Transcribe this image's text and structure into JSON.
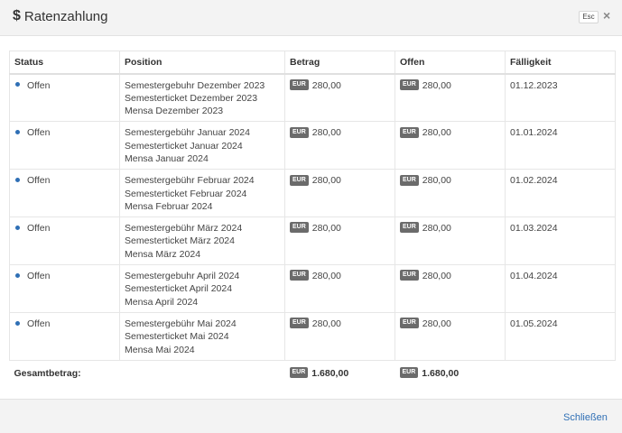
{
  "header": {
    "icon": "dollar-icon",
    "title": "Ratenzahlung",
    "esc_label": "Esc",
    "close_symbol": "×"
  },
  "table": {
    "columns": [
      "Status",
      "Position",
      "Betrag",
      "Offen",
      "Fälligkeit"
    ],
    "currency": "EUR",
    "rows": [
      {
        "status": "Offen",
        "pos1": "Semestergebuhr Dezember 2023",
        "pos2": "Semesterticket Dezember 2023",
        "pos3": "Mensa Dezember 2023",
        "betrag": "280,00",
        "offen": "280,00",
        "faellig": "01.12.2023"
      },
      {
        "status": "Offen",
        "pos1": "Semestergebühr Januar 2024",
        "pos2": "Semesterticket Januar 2024",
        "pos3": "Mensa Januar 2024",
        "betrag": "280,00",
        "offen": "280,00",
        "faellig": "01.01.2024"
      },
      {
        "status": "Offen",
        "pos1": "Semestergebühr Februar 2024",
        "pos2": "Semesterticket Februar 2024",
        "pos3": "Mensa Februar 2024",
        "betrag": "280,00",
        "offen": "280,00",
        "faellig": "01.02.2024"
      },
      {
        "status": "Offen",
        "pos1": "Semestergebühr März 2024",
        "pos2": "Semesterticket März 2024",
        "pos3": "Mensa März 2024",
        "betrag": "280,00",
        "offen": "280,00",
        "faellig": "01.03.2024"
      },
      {
        "status": "Offen",
        "pos1": "Semestergebuhr April 2024",
        "pos2": "Semesterticket April 2024",
        "pos3": "Mensa April 2024",
        "betrag": "280,00",
        "offen": "280,00",
        "faellig": "01.04.2024"
      },
      {
        "status": "Offen",
        "pos1": "Semestergebühr Mai 2024",
        "pos2": "Semesterticket Mai 2024",
        "pos3": "Mensa Mai 2024",
        "betrag": "280,00",
        "offen": "280,00",
        "faellig": "01.05.2024"
      }
    ],
    "total": {
      "label": "Gesamtbetrag:",
      "betrag": "1.680,00",
      "offen": "1.680,00"
    }
  },
  "footer": {
    "close_label": "Schließen"
  },
  "colors": {
    "accent": "#2f6fb5",
    "badge": "#6b6b6b",
    "bar": "#f3f3f3"
  }
}
